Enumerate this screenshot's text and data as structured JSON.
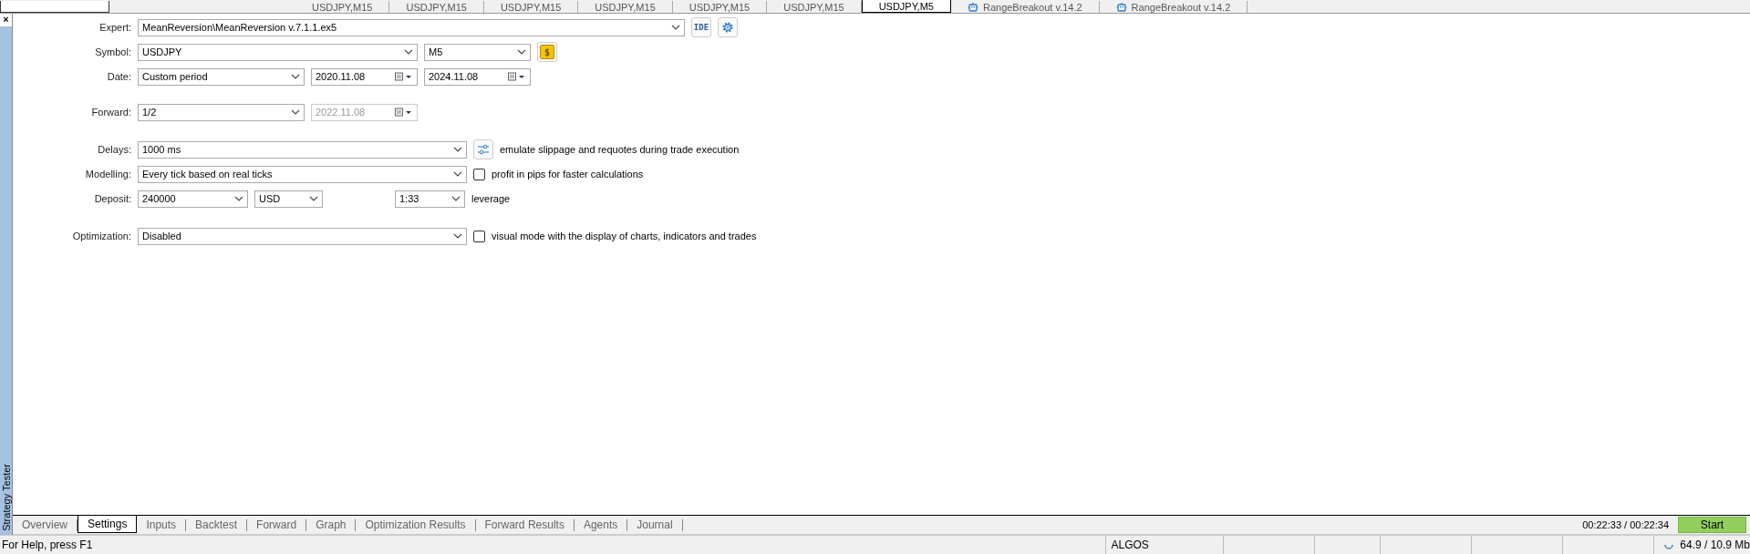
{
  "chart_tabs": [
    {
      "label": "USDJPY,M15",
      "selected": false,
      "kind": "chart"
    },
    {
      "label": "USDJPY,M15",
      "selected": false,
      "kind": "chart"
    },
    {
      "label": "USDJPY,M15",
      "selected": false,
      "kind": "chart"
    },
    {
      "label": "USDJPY,M15",
      "selected": false,
      "kind": "chart"
    },
    {
      "label": "USDJPY,M15",
      "selected": false,
      "kind": "chart"
    },
    {
      "label": "USDJPY,M15",
      "selected": false,
      "kind": "chart"
    },
    {
      "label": "USDJPY,M5",
      "selected": true,
      "kind": "chart"
    },
    {
      "label": "RangeBreakout v.14.2",
      "selected": false,
      "kind": "expert"
    },
    {
      "label": "RangeBreakout v.14.2",
      "selected": false,
      "kind": "expert"
    }
  ],
  "panel": {
    "close": "×",
    "title": "Strategy Tester"
  },
  "settings": {
    "expert": {
      "label": "Expert:",
      "value": "MeanReversion\\MeanReversion v.7.1.1.ex5",
      "ide": "IDE"
    },
    "symbol": {
      "label": "Symbol:",
      "value": "USDJPY",
      "timeframe": "M5",
      "currency": "$"
    },
    "date": {
      "label": "Date:",
      "value": "Custom period",
      "from": "2020.11.08",
      "to": "2024.11.08"
    },
    "forward": {
      "label": "Forward:",
      "value": "1/2",
      "date": "2022.11.08",
      "date_disabled": true
    },
    "delays": {
      "label": "Delays:",
      "value": "1000 ms",
      "note": "emulate slippage and requotes during trade execution"
    },
    "modelling": {
      "label": "Modelling:",
      "value": "Every tick based on real ticks",
      "option": "profit in pips for faster calculations",
      "checked": false
    },
    "deposit": {
      "label": "Deposit:",
      "value": "240000",
      "currency": "USD",
      "leverage_value": "1:33",
      "leverage": "leverage"
    },
    "optimization": {
      "label": "Optimization:",
      "value": "Disabled",
      "option": "visual mode with the display of charts, indicators and trades",
      "checked": false
    }
  },
  "bottom_tabs": [
    {
      "label": "Overview",
      "selected": false
    },
    {
      "label": "Settings",
      "selected": true
    },
    {
      "label": "Inputs",
      "selected": false
    },
    {
      "label": "Backtest",
      "selected": false
    },
    {
      "label": "Forward",
      "selected": false
    },
    {
      "label": "Graph",
      "selected": false
    },
    {
      "label": "Optimization Results",
      "selected": false
    },
    {
      "label": "Forward Results",
      "selected": false
    },
    {
      "label": "Agents",
      "selected": false
    },
    {
      "label": "Journal",
      "selected": false
    }
  ],
  "timer": "00:22:33 / 00:22:34",
  "start": "Start",
  "status_bar": {
    "help": "For Help, press F1",
    "account": "ALGOS",
    "memory": "64.9 / 10.9 Mb"
  }
}
